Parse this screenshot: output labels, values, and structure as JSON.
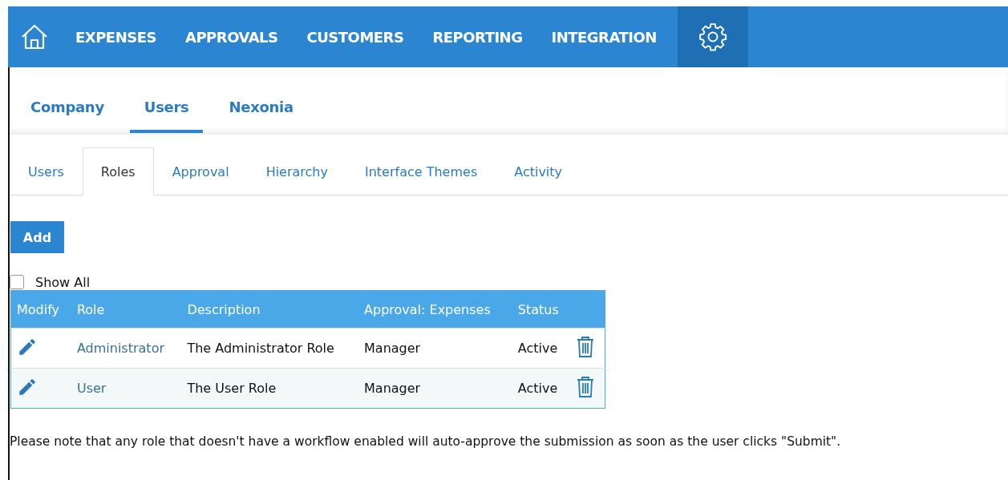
{
  "nav": {
    "items": [
      {
        "label": "EXPENSES",
        "selected": false
      },
      {
        "label": "APPROVALS",
        "selected": false
      },
      {
        "label": "CUSTOMERS",
        "selected": false
      },
      {
        "label": "REPORTING",
        "selected": false
      },
      {
        "label": "INTEGRATION",
        "selected": false
      }
    ],
    "settings": {
      "selected": true
    }
  },
  "section_tabs": [
    {
      "label": "Company",
      "selected": false
    },
    {
      "label": "Users",
      "selected": true
    },
    {
      "label": "Nexonia",
      "selected": false
    }
  ],
  "sub_tabs": [
    {
      "label": "Users",
      "selected": false
    },
    {
      "label": "Roles",
      "selected": true
    },
    {
      "label": "Approval",
      "selected": false
    },
    {
      "label": "Hierarchy",
      "selected": false
    },
    {
      "label": "Interface Themes",
      "selected": false
    },
    {
      "label": "Activity",
      "selected": false
    }
  ],
  "add_button": "Add",
  "show_all": {
    "label": "Show All",
    "checked": false
  },
  "table": {
    "columns": [
      "Modify",
      "Role",
      "Description",
      "Approval: Expenses",
      "Status"
    ],
    "rows": [
      {
        "role": "Administrator",
        "description": "The Administrator Role",
        "approval": "Manager",
        "status": "Active"
      },
      {
        "role": "User",
        "description": "The User Role",
        "approval": "Manager",
        "status": "Active"
      }
    ]
  },
  "note": "Please note that any role that doesn't have a workflow enabled will auto-approve the submission as soon as the user clicks \"Submit\"."
}
